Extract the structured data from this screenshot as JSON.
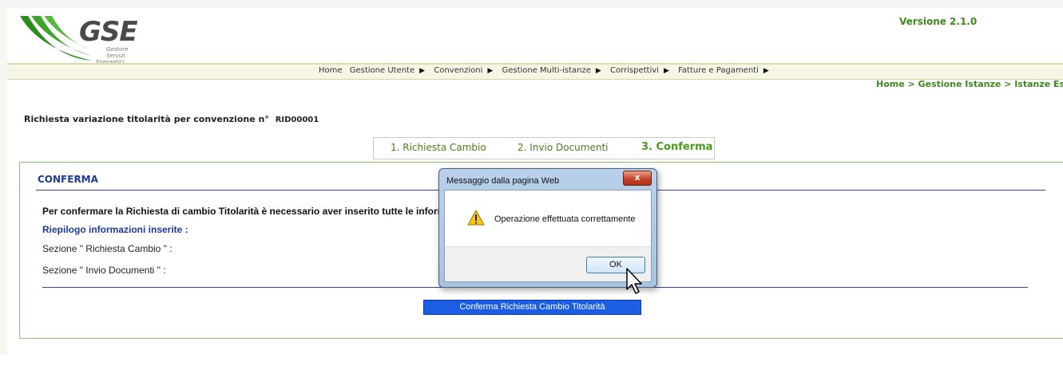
{
  "header": {
    "logo_text": "GSE",
    "logo_sub": [
      "Gestore",
      "Servizi",
      "Energetici"
    ],
    "version": "Versione 2.1.0"
  },
  "menu": {
    "items": [
      {
        "label": "Home",
        "has_arrow": false
      },
      {
        "label": "Gestione Utente",
        "has_arrow": true
      },
      {
        "label": "Convenzioni",
        "has_arrow": true
      },
      {
        "label": "Gestione Multi-istanze",
        "has_arrow": true
      },
      {
        "label": "Corrispettivi",
        "has_arrow": true
      },
      {
        "label": "Fatture e Pagamenti",
        "has_arrow": true
      }
    ],
    "arrow_glyph": "▶"
  },
  "breadcrumb": "Home > Gestione Istanze > Istanze Esistenti",
  "page": {
    "title": "Richiesta variazione titolarità per convenzione n°",
    "code": "RID00001"
  },
  "steps": [
    {
      "label": "1. Richiesta Cambio",
      "active": false
    },
    {
      "label": "2. Invio Documenti",
      "active": false
    },
    {
      "label": "3. Conferma",
      "active": true
    }
  ],
  "panel": {
    "title": "CONFERMA",
    "instruction": "Per confermare la Richiesta di cambio Titolarità è necessario aver inserito tutte le informa",
    "summary_heading": "Riepilogo informazioni inserite :",
    "section1": "Sezione \" Richiesta Cambio \" :",
    "section2": "Sezione \" Invio Documenti \" :",
    "confirm_button": "Conferma Richiesta Cambio Titolarità"
  },
  "dialog": {
    "title": "Messaggio dalla pagina Web",
    "close_label": "x",
    "message": "Operazione effettuata correttamente",
    "ok_label": "OK",
    "icon": "warning-icon"
  },
  "colors": {
    "brand_green": "#3c8a1c",
    "heading_blue": "#1a3a9c",
    "button_blue": "#1c5ee3"
  }
}
